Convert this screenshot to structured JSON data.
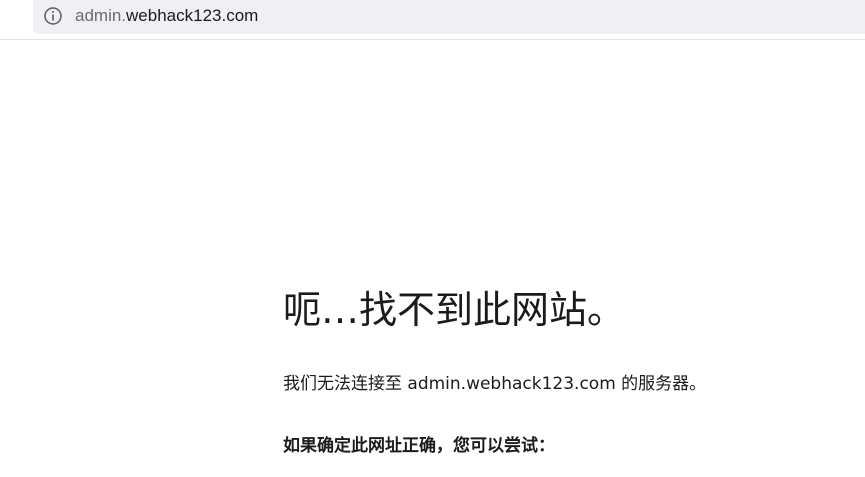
{
  "address_bar": {
    "subdomain": "admin.",
    "domain": "webhack123.com",
    "info_icon": "info-icon"
  },
  "error_page": {
    "title": "呃…找不到此网站。",
    "message": "我们无法连接至 admin.webhack123.com 的服务器。",
    "suggestion_heading": "如果确定此网址正确，您可以尝试："
  }
}
